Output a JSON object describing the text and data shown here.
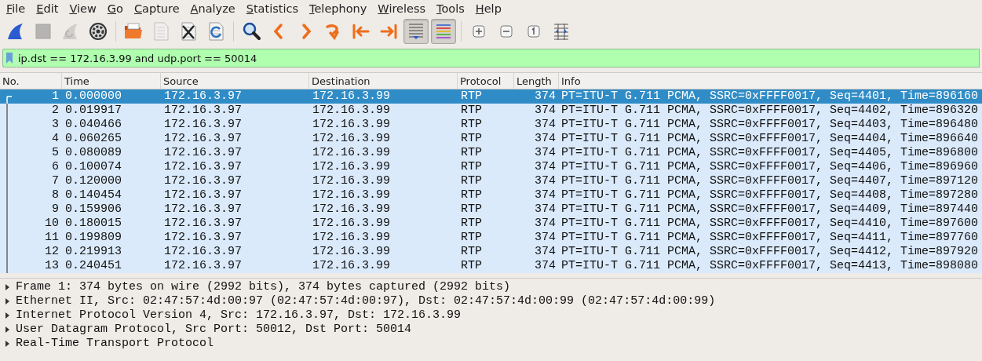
{
  "menu": [
    "File",
    "Edit",
    "View",
    "Go",
    "Capture",
    "Analyze",
    "Statistics",
    "Telephony",
    "Wireless",
    "Tools",
    "Help"
  ],
  "toolbar": [
    {
      "kind": "fin",
      "disabled": false,
      "pressed": false
    },
    {
      "kind": "stop",
      "disabled": true,
      "pressed": false
    },
    {
      "kind": "restart",
      "disabled": true,
      "pressed": false
    },
    {
      "kind": "gear",
      "disabled": false,
      "pressed": false
    },
    {
      "kind": "sep"
    },
    {
      "kind": "folder",
      "disabled": false,
      "pressed": false
    },
    {
      "kind": "file",
      "disabled": true,
      "pressed": false
    },
    {
      "kind": "closefile",
      "disabled": false,
      "pressed": false
    },
    {
      "kind": "reload",
      "disabled": false,
      "pressed": false
    },
    {
      "kind": "sep"
    },
    {
      "kind": "search",
      "disabled": false,
      "pressed": false
    },
    {
      "kind": "back",
      "disabled": false,
      "pressed": false
    },
    {
      "kind": "forward",
      "disabled": false,
      "pressed": false
    },
    {
      "kind": "jump",
      "disabled": false,
      "pressed": false
    },
    {
      "kind": "first",
      "disabled": false,
      "pressed": false
    },
    {
      "kind": "last",
      "disabled": false,
      "pressed": false
    },
    {
      "kind": "autoscroll",
      "disabled": false,
      "pressed": true
    },
    {
      "kind": "colorize",
      "disabled": false,
      "pressed": true
    },
    {
      "kind": "sep"
    },
    {
      "kind": "zoomin",
      "disabled": false,
      "pressed": false
    },
    {
      "kind": "zoomout",
      "disabled": false,
      "pressed": false
    },
    {
      "kind": "normal",
      "disabled": false,
      "pressed": false
    },
    {
      "kind": "resize",
      "disabled": false,
      "pressed": false
    }
  ],
  "filter": {
    "value": "ip.dst == 172.16.3.99 and udp.port == 50014"
  },
  "columns": [
    "No.",
    "Time",
    "Source",
    "Destination",
    "Protocol",
    "Length",
    "Info"
  ],
  "rows": [
    {
      "selected": true,
      "cells": [
        "1",
        "0.000000",
        "172.16.3.97",
        "172.16.3.99",
        "RTP",
        "374",
        "PT=ITU-T G.711 PCMA, SSRC=0xFFFF0017, Seq=4401, Time=896160"
      ]
    },
    {
      "selected": false,
      "cells": [
        "2",
        "0.019917",
        "172.16.3.97",
        "172.16.3.99",
        "RTP",
        "374",
        "PT=ITU-T G.711 PCMA, SSRC=0xFFFF0017, Seq=4402, Time=896320"
      ]
    },
    {
      "selected": false,
      "cells": [
        "3",
        "0.040466",
        "172.16.3.97",
        "172.16.3.99",
        "RTP",
        "374",
        "PT=ITU-T G.711 PCMA, SSRC=0xFFFF0017, Seq=4403, Time=896480"
      ]
    },
    {
      "selected": false,
      "cells": [
        "4",
        "0.060265",
        "172.16.3.97",
        "172.16.3.99",
        "RTP",
        "374",
        "PT=ITU-T G.711 PCMA, SSRC=0xFFFF0017, Seq=4404, Time=896640"
      ]
    },
    {
      "selected": false,
      "cells": [
        "5",
        "0.080089",
        "172.16.3.97",
        "172.16.3.99",
        "RTP",
        "374",
        "PT=ITU-T G.711 PCMA, SSRC=0xFFFF0017, Seq=4405, Time=896800"
      ]
    },
    {
      "selected": false,
      "cells": [
        "6",
        "0.100074",
        "172.16.3.97",
        "172.16.3.99",
        "RTP",
        "374",
        "PT=ITU-T G.711 PCMA, SSRC=0xFFFF0017, Seq=4406, Time=896960"
      ]
    },
    {
      "selected": false,
      "cells": [
        "7",
        "0.120000",
        "172.16.3.97",
        "172.16.3.99",
        "RTP",
        "374",
        "PT=ITU-T G.711 PCMA, SSRC=0xFFFF0017, Seq=4407, Time=897120"
      ]
    },
    {
      "selected": false,
      "cells": [
        "8",
        "0.140454",
        "172.16.3.97",
        "172.16.3.99",
        "RTP",
        "374",
        "PT=ITU-T G.711 PCMA, SSRC=0xFFFF0017, Seq=4408, Time=897280"
      ]
    },
    {
      "selected": false,
      "cells": [
        "9",
        "0.159906",
        "172.16.3.97",
        "172.16.3.99",
        "RTP",
        "374",
        "PT=ITU-T G.711 PCMA, SSRC=0xFFFF0017, Seq=4409, Time=897440"
      ]
    },
    {
      "selected": false,
      "cells": [
        "10",
        "0.180015",
        "172.16.3.97",
        "172.16.3.99",
        "RTP",
        "374",
        "PT=ITU-T G.711 PCMA, SSRC=0xFFFF0017, Seq=4410, Time=897600"
      ]
    },
    {
      "selected": false,
      "cells": [
        "11",
        "0.199809",
        "172.16.3.97",
        "172.16.3.99",
        "RTP",
        "374",
        "PT=ITU-T G.711 PCMA, SSRC=0xFFFF0017, Seq=4411, Time=897760"
      ]
    },
    {
      "selected": false,
      "cells": [
        "12",
        "0.219913",
        "172.16.3.97",
        "172.16.3.99",
        "RTP",
        "374",
        "PT=ITU-T G.711 PCMA, SSRC=0xFFFF0017, Seq=4412, Time=897920"
      ]
    },
    {
      "selected": false,
      "cells": [
        "13",
        "0.240451",
        "172.16.3.97",
        "172.16.3.99",
        "RTP",
        "374",
        "PT=ITU-T G.711 PCMA, SSRC=0xFFFF0017, Seq=4413, Time=898080"
      ]
    }
  ],
  "details": [
    {
      "label": "Frame 1: 374 bytes on wire (2992 bits), 374 bytes captured (2992 bits)",
      "expanded": false
    },
    {
      "label": "Ethernet II, Src: 02:47:57:4d:00:97 (02:47:57:4d:00:97), Dst: 02:47:57:4d:00:99 (02:47:57:4d:00:99)",
      "expanded": false
    },
    {
      "label": "Internet Protocol Version 4, Src: 172.16.3.97, Dst: 172.16.3.99",
      "expanded": false
    },
    {
      "label": "User Datagram Protocol, Src Port: 50012, Dst Port: 50014",
      "expanded": false
    },
    {
      "label": "Real-Time Transport Protocol",
      "expanded": false
    }
  ]
}
